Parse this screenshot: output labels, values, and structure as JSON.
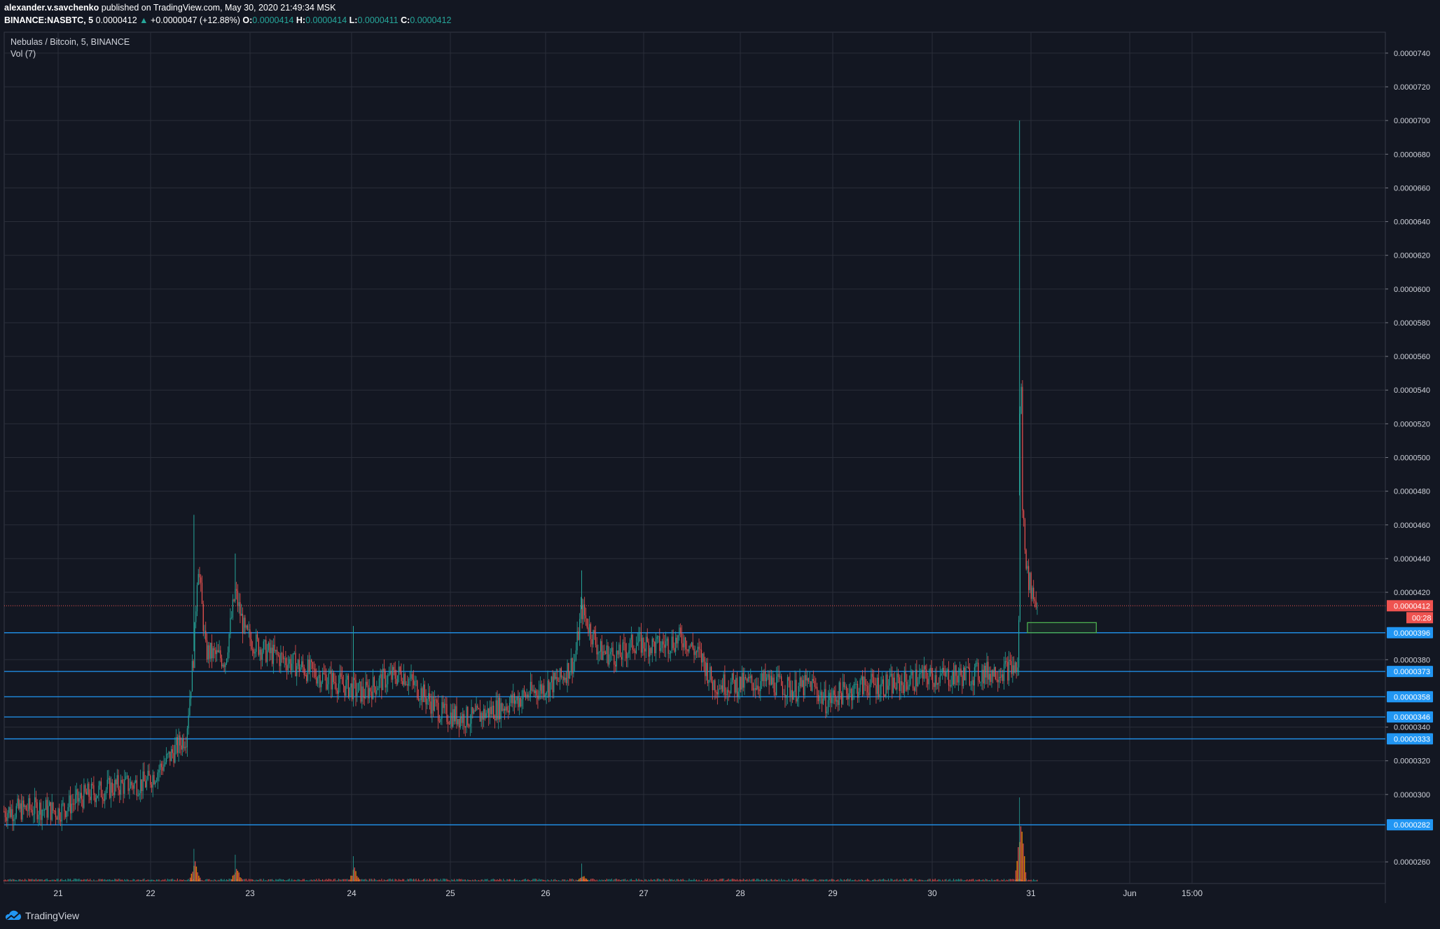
{
  "header": {
    "author": "alexander.v.savchenko",
    "published_text": "published on TradingView.com, May 30, 2020 21:49:34 MSK",
    "symbol": "BINANCE:NASBTC, 5",
    "last": "0.0000412",
    "change": "+0.0000047 (+12.88%)",
    "o_label": "O:",
    "o_value": "0.0000414",
    "h_label": "H:",
    "h_value": "0.0000414",
    "l_label": "L:",
    "l_value": "0.0000411",
    "c_label": "C:",
    "c_value": "0.0000412"
  },
  "footer": {
    "brand": "TradingView"
  },
  "colors": {
    "background": "#131722",
    "grid": "#2a2e39",
    "up": "#26a69a",
    "down": "#ef5350",
    "hline": "#2196f3",
    "price_line": "#ef5350",
    "box": "#4caf50"
  },
  "chart_data": {
    "type": "candlestick",
    "title": "Nebulas / Bitcoin, 5, BINANCE",
    "volume_label": "Vol (7)",
    "x_ticks": [
      "21",
      "22",
      "23",
      "24",
      "25",
      "26",
      "27",
      "28",
      "29",
      "30",
      "31",
      "Jun",
      "15:00"
    ],
    "y_ticks": [
      "0.0000740",
      "0.0000720",
      "0.0000700",
      "0.0000680",
      "0.0000660",
      "0.0000640",
      "0.0000620",
      "0.0000600",
      "0.0000580",
      "0.0000560",
      "0.0000540",
      "0.0000520",
      "0.0000500",
      "0.0000480",
      "0.0000460",
      "0.0000440",
      "0.0000420",
      "0.0000380",
      "0.0000340",
      "0.0000320",
      "0.0000300",
      "0.0000260"
    ],
    "ylim": [
      2.48e-05,
      7.52e-05
    ],
    "current_price": {
      "label": "0.0000412",
      "value": 4.12e-05,
      "countdown": "00:28"
    },
    "horizontal_levels": [
      {
        "label": "0.0000396",
        "value": 3.96e-05
      },
      {
        "label": "0.0000373",
        "value": 3.73e-05
      },
      {
        "label": "0.0000358",
        "value": 3.58e-05
      },
      {
        "label": "0.0000346",
        "value": 3.46e-05
      },
      {
        "label": "0.0000333",
        "value": 3.33e-05
      },
      {
        "label": "0.0000282",
        "value": 2.82e-05
      }
    ],
    "target_box": {
      "x_from": 30.85,
      "x_to": 31.55,
      "y_low": 3.96e-05,
      "y_high": 4.02e-05
    },
    "price_path": [
      [
        20.45,
        2.9e-05
      ],
      [
        20.8,
        2.92e-05
      ],
      [
        21.0,
        2.9e-05
      ],
      [
        21.3,
        3e-05
      ],
      [
        21.6,
        3.05e-05
      ],
      [
        21.9,
        3.07e-05
      ],
      [
        22.1,
        3.2e-05
      ],
      [
        22.3,
        3.35e-05
      ],
      [
        22.38,
        3.85e-05
      ],
      [
        22.42,
        4.4e-05
      ],
      [
        22.5,
        3.85e-05
      ],
      [
        22.7,
        3.8e-05
      ],
      [
        22.8,
        4.2e-05
      ],
      [
        22.9,
        3.95e-05
      ],
      [
        23.1,
        3.85e-05
      ],
      [
        23.3,
        3.8e-05
      ],
      [
        23.6,
        3.72e-05
      ],
      [
        23.9,
        3.65e-05
      ],
      [
        24.1,
        3.6e-05
      ],
      [
        24.3,
        3.68e-05
      ],
      [
        24.5,
        3.72e-05
      ],
      [
        24.7,
        3.6e-05
      ],
      [
        24.9,
        3.48e-05
      ],
      [
        25.2,
        3.45e-05
      ],
      [
        25.5,
        3.52e-05
      ],
      [
        25.8,
        3.6e-05
      ],
      [
        26.1,
        3.68e-05
      ],
      [
        26.25,
        3.8e-05
      ],
      [
        26.32,
        4.1e-05
      ],
      [
        26.5,
        3.85e-05
      ],
      [
        26.7,
        3.82e-05
      ],
      [
        26.85,
        3.9e-05
      ],
      [
        27.1,
        3.88e-05
      ],
      [
        27.35,
        3.93e-05
      ],
      [
        27.55,
        3.8e-05
      ],
      [
        27.65,
        3.66e-05
      ],
      [
        27.9,
        3.65e-05
      ],
      [
        28.2,
        3.67e-05
      ],
      [
        28.5,
        3.62e-05
      ],
      [
        28.65,
        3.66e-05
      ],
      [
        28.8,
        3.55e-05
      ],
      [
        28.95,
        3.6e-05
      ],
      [
        29.2,
        3.65e-05
      ],
      [
        29.5,
        3.65e-05
      ],
      [
        29.8,
        3.7e-05
      ],
      [
        30.1,
        3.7e-05
      ],
      [
        30.4,
        3.72e-05
      ],
      [
        30.7,
        3.75e-05
      ],
      [
        30.76,
        3.75e-05
      ],
      [
        30.78,
        5.8e-05
      ],
      [
        30.8,
        4.7e-05
      ],
      [
        30.85,
        4.3e-05
      ],
      [
        30.9,
        4.2e-05
      ],
      [
        30.95,
        4.12e-05
      ]
    ],
    "wick_peaks": [
      {
        "x": 22.38,
        "high": 4.66e-05
      },
      {
        "x": 22.8,
        "high": 4.43e-05
      },
      {
        "x": 24.0,
        "high": 4e-05
      },
      {
        "x": 26.32,
        "high": 4.33e-05
      },
      {
        "x": 30.77,
        "high": 7e-05
      }
    ],
    "volume_spikes": [
      {
        "x": 22.38,
        "rel": 0.3
      },
      {
        "x": 22.8,
        "rel": 0.22
      },
      {
        "x": 24.0,
        "rel": 0.2
      },
      {
        "x": 26.32,
        "rel": 0.1
      },
      {
        "x": 30.77,
        "rel": 1.0
      }
    ]
  }
}
